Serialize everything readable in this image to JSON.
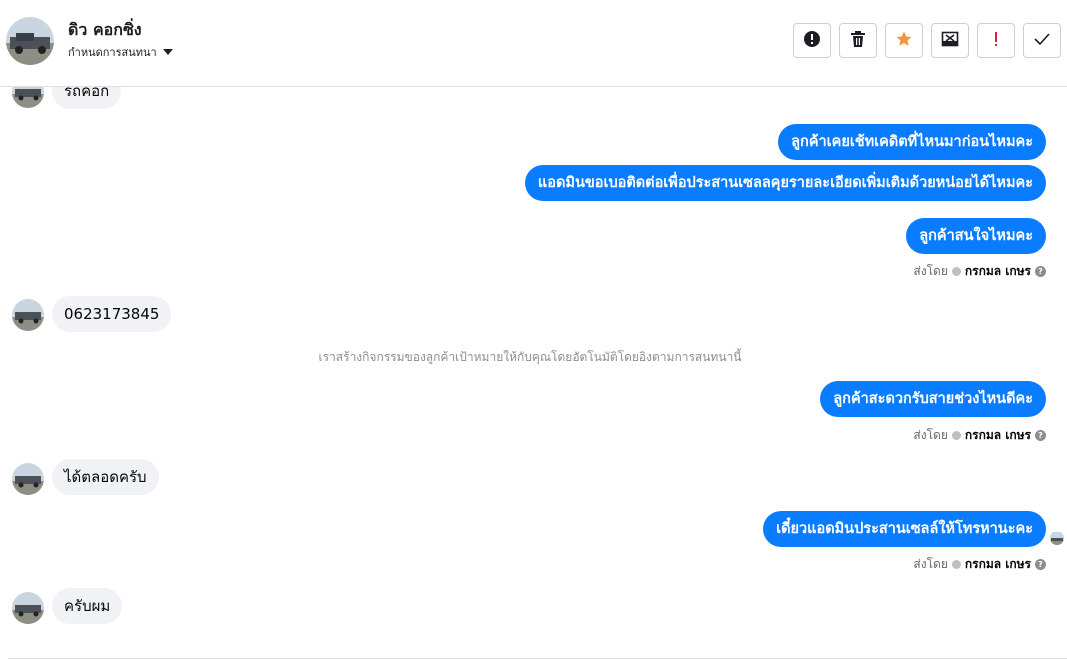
{
  "header": {
    "name": "ดิว คอกซิ่ง",
    "subtitle": "กำหนดการสนทนา",
    "tool_icons": [
      "alert-icon",
      "trash-icon",
      "star-icon",
      "inbox-x-icon",
      "exclamation-icon",
      "check-icon"
    ],
    "colors": {
      "star": "#f7923b",
      "exclamation": "#e41e3f"
    }
  },
  "messages": {
    "m0": "รถคอก",
    "m1": "ลูกค้าเคยเช้ทเคดิตที่ไหนมาก่อนไหมคะ",
    "m2": "แอดมินขอเบอติดต่อเพื่อประสานเซลลคุยรายละเอียดเพิ่มเติมด้วยหน่อยได้ไหมคะ",
    "m3": "ลูกค้าสนใจไหมคะ",
    "m4": "0623173845",
    "m5": "ลูกค้าสะดวกรับสายช่วงไหนดีคะ",
    "m6": "ได้ตลอดครับ",
    "m7": "เดี๋ยวแอดมินประสานเซลล์ให้โทรหานะคะ",
    "m8": "ครับผม"
  },
  "sent_by": {
    "prefix": "ส่งโดย",
    "name": "กรกมล เกษร",
    "help": "?"
  },
  "system_note": "เราสร้างกิจกรรมของลูกค้าเป้าหมายให้กับคุณโดยอัตโนมัติโดยอิงตามการสนทนานี้",
  "colors": {
    "outgoing": "#0a7cff",
    "incoming": "#f0f2f5"
  }
}
